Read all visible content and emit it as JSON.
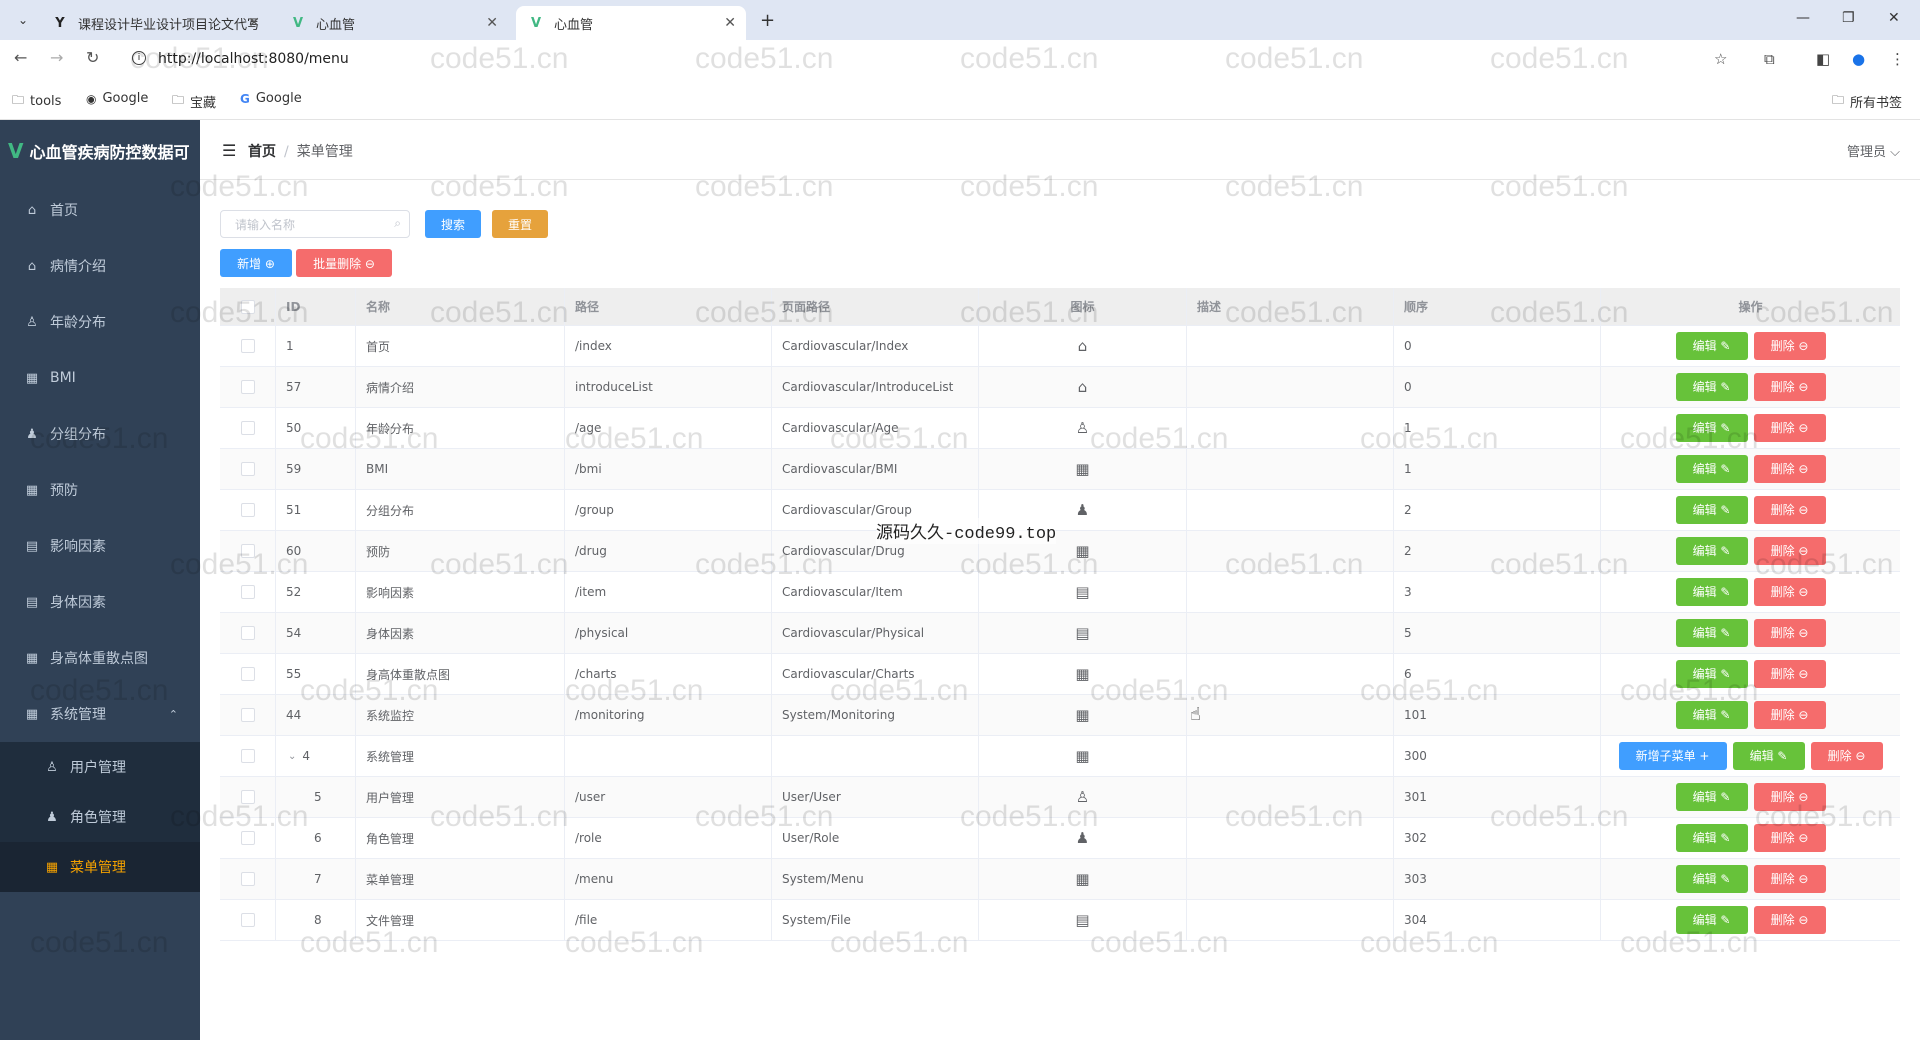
{
  "browser": {
    "tabs": [
      {
        "title": "课程设计毕业设计项目论文代写",
        "active": false
      },
      {
        "title": "心血管",
        "active": false
      },
      {
        "title": "心血管",
        "active": true
      }
    ],
    "url": "http://localhost:8080/menu",
    "bookmarks": [
      "tools",
      "Google",
      "宝藏",
      "Google"
    ],
    "bookmarks_right": "所有书签"
  },
  "sidebar": {
    "title": "心血管疾病防控数据可",
    "items": [
      {
        "label": "首页",
        "icon": "home-icon"
      },
      {
        "label": "病情介绍",
        "icon": "home-icon"
      },
      {
        "label": "年龄分布",
        "icon": "user-icon"
      },
      {
        "label": "BMI",
        "icon": "grid-icon"
      },
      {
        "label": "分组分布",
        "icon": "user-solid-icon"
      },
      {
        "label": "预防",
        "icon": "grid-icon"
      },
      {
        "label": "影响因素",
        "icon": "document-icon"
      },
      {
        "label": "身体因素",
        "icon": "document-icon"
      },
      {
        "label": "身高体重散点图",
        "icon": "grid-icon"
      },
      {
        "label": "系统管理",
        "icon": "grid-icon"
      }
    ],
    "sub_items": [
      {
        "label": "用户管理",
        "icon": "user-icon"
      },
      {
        "label": "角色管理",
        "icon": "user-solid-icon"
      },
      {
        "label": "菜单管理",
        "icon": "grid-icon"
      }
    ]
  },
  "header": {
    "breadcrumb_home": "首页",
    "breadcrumb_sep": "/",
    "breadcrumb_current": "菜单管理",
    "user": "管理员 ⌵"
  },
  "toolbar": {
    "search_placeholder": "请输入名称",
    "search_btn": "搜索",
    "reset_btn": "重置",
    "add_btn": "新增 ⊕",
    "batch_delete_btn": "批量删除 ⊖"
  },
  "table": {
    "columns": [
      "ID",
      "名称",
      "路径",
      "页面路径",
      "图标",
      "描述",
      "顺序",
      "操作"
    ],
    "rows": [
      {
        "id": "1",
        "name": "首页",
        "path": "/index",
        "page": "Cardiovascular/Index",
        "icon": "home",
        "desc": "",
        "order": "0"
      },
      {
        "id": "57",
        "name": "病情介绍",
        "path": "introduceList",
        "page": "Cardiovascular/IntroduceList",
        "icon": "home",
        "desc": "",
        "order": "0"
      },
      {
        "id": "50",
        "name": "年龄分布",
        "path": "/age",
        "page": "Cardiovascular/Age",
        "icon": "user",
        "desc": "",
        "order": "1"
      },
      {
        "id": "59",
        "name": "BMI",
        "path": "/bmi",
        "page": "Cardiovascular/BMI",
        "icon": "grid",
        "desc": "",
        "order": "1"
      },
      {
        "id": "51",
        "name": "分组分布",
        "path": "/group",
        "page": "Cardiovascular/Group",
        "icon": "user-solid",
        "desc": "",
        "order": "2"
      },
      {
        "id": "60",
        "name": "预防",
        "path": "/drug",
        "page": "Cardiovascular/Drug",
        "icon": "grid",
        "desc": "",
        "order": "2"
      },
      {
        "id": "52",
        "name": "影响因素",
        "path": "/item",
        "page": "Cardiovascular/Item",
        "icon": "document",
        "desc": "",
        "order": "3"
      },
      {
        "id": "54",
        "name": "身体因素",
        "path": "/physical",
        "page": "Cardiovascular/Physical",
        "icon": "document",
        "desc": "",
        "order": "5"
      },
      {
        "id": "55",
        "name": "身高体重散点图",
        "path": "/charts",
        "page": "Cardiovascular/Charts",
        "icon": "grid9",
        "desc": "",
        "order": "6"
      },
      {
        "id": "44",
        "name": "系统监控",
        "path": "/monitoring",
        "page": "System/Monitoring",
        "icon": "grid",
        "desc": "",
        "order": "101"
      },
      {
        "id": "4",
        "name": "系统管理",
        "path": "",
        "page": "",
        "icon": "grid9",
        "desc": "",
        "order": "300",
        "parent": true
      },
      {
        "id": "5",
        "name": "用户管理",
        "path": "/user",
        "page": "User/User",
        "icon": "user",
        "desc": "",
        "order": "301",
        "child": true
      },
      {
        "id": "6",
        "name": "角色管理",
        "path": "/role",
        "page": "User/Role",
        "icon": "user-solid",
        "desc": "",
        "order": "302",
        "child": true
      },
      {
        "id": "7",
        "name": "菜单管理",
        "path": "/menu",
        "page": "System/Menu",
        "icon": "grid",
        "desc": "",
        "order": "303",
        "child": true
      },
      {
        "id": "8",
        "name": "文件管理",
        "path": "/file",
        "page": "System/File",
        "icon": "document",
        "desc": "",
        "order": "304",
        "child": true
      }
    ],
    "edit_label": "编辑 ✎",
    "delete_label": "删除 ⊖",
    "add_sub_label": "新增子菜单 +"
  },
  "watermark": {
    "text": "code51.cn",
    "center_text": "源码久久-code99.top"
  },
  "colors": {
    "sidebar_bg": "#304156",
    "active_menu": "#f4a100",
    "primary": "#409eff",
    "success": "#67c23a",
    "danger": "#f56c6c",
    "warning": "#e6a23c"
  }
}
